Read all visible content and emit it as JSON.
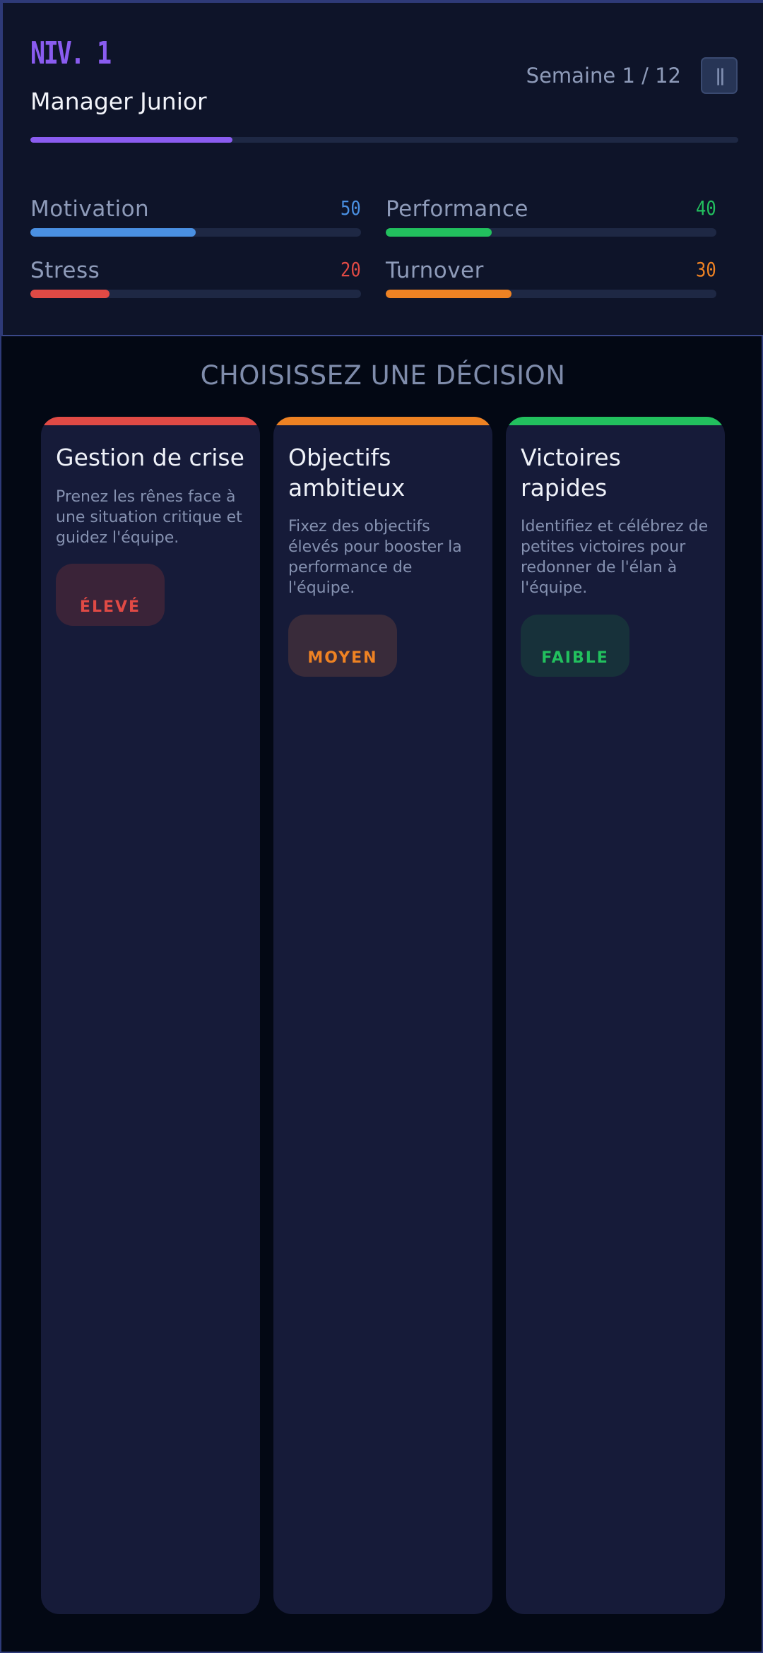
{
  "hud": {
    "level": "NIV. 1",
    "role": "Manager Junior",
    "week": "Semaine 1 / 12",
    "pause_icon": "pause-icon",
    "xp_progress": 0.285,
    "xp_color": "#8a5cf0",
    "stats": [
      {
        "label": "Motivation",
        "value": "50",
        "fraction": 0.5,
        "color": "#4a90e2"
      },
      {
        "label": "Performance",
        "value": "40",
        "fraction": 0.32,
        "color": "#22c05e"
      },
      {
        "label": "Stress",
        "value": "20",
        "fraction": 0.24,
        "color": "#e04a45"
      },
      {
        "label": "Turnover",
        "value": "30",
        "fraction": 0.38,
        "color": "#ee8223"
      }
    ]
  },
  "decisions": {
    "heading": "CHOISISSEZ UNE DÉCISION",
    "cards": [
      {
        "title": "Gestion de crise",
        "description": "Prenez les rênes face à une situation critique et guidez l'équipe.",
        "risk": "ÉLEVÉ",
        "color": "#e04a45",
        "badge_bg": "#3a2338"
      },
      {
        "title": "Objectifs ambitieux",
        "description": "Fixez des objectifs élevés pour booster la performance de l'équipe.",
        "risk": "MOYEN",
        "color": "#ee8223",
        "badge_bg": "#392b3a"
      },
      {
        "title": "Victoires rapides",
        "description": "Identifiez et célébrez de petites victoires pour redonner de l'élan à l'équipe.",
        "risk": "FAIBLE",
        "color": "#22c05e",
        "badge_bg": "#17313a"
      }
    ]
  }
}
